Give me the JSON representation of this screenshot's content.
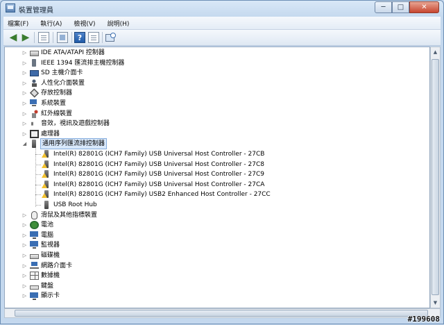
{
  "window": {
    "title": "裝置管理員",
    "controls": {
      "minimize": "─",
      "maximize": "□",
      "close": "✕"
    }
  },
  "menu": [
    "檔案(F)",
    "執行(A)",
    "檢視(V)",
    "說明(H)"
  ],
  "toolbar": {
    "icons": [
      "back-arrow-icon",
      "forward-arrow-icon",
      "grid-view-icon",
      "properties-icon",
      "help-icon",
      "display-icon",
      "scan-hardware-icon"
    ]
  },
  "tree": [
    {
      "label": "IDE ATA/ATAPI 控制器",
      "icon": "ide-controller-icon",
      "level": 0,
      "expanded": false
    },
    {
      "label": "IEEE 1394 匯流排主機控制器",
      "icon": "ieee1394-icon",
      "level": 0,
      "expanded": false
    },
    {
      "label": "SD 主機介面卡",
      "icon": "sd-card-icon",
      "level": 0,
      "expanded": false
    },
    {
      "label": "人性化介面裝置",
      "icon": "hid-icon",
      "level": 0,
      "expanded": false
    },
    {
      "label": "存放控制器",
      "icon": "storage-controller-icon",
      "level": 0,
      "expanded": false
    },
    {
      "label": "系統裝置",
      "icon": "system-device-icon",
      "level": 0,
      "expanded": false
    },
    {
      "label": "紅外線裝置",
      "icon": "infrared-icon",
      "level": 0,
      "expanded": false
    },
    {
      "label": "音效，視訊及遊戲控制器",
      "icon": "speaker-icon",
      "level": 0,
      "expanded": false
    },
    {
      "label": "處理器",
      "icon": "processor-icon",
      "level": 0,
      "expanded": false
    },
    {
      "label": "通用序列匯流排控制器",
      "icon": "usb-controller-icon",
      "level": 0,
      "expanded": true,
      "selected": true
    },
    {
      "label": "Intel(R) 82801G (ICH7 Family) USB Universal Host Controller - 27CB",
      "icon": "usb-warning-icon",
      "level": 1
    },
    {
      "label": "Intel(R) 82801G (ICH7 Family) USB Universal Host Controller - 27C8",
      "icon": "usb-warning-icon",
      "level": 1
    },
    {
      "label": "Intel(R) 82801G (ICH7 Family) USB Universal Host Controller - 27C9",
      "icon": "usb-warning-icon",
      "level": 1
    },
    {
      "label": "Intel(R) 82801G (ICH7 Family) USB Universal Host Controller - 27CA",
      "icon": "usb-warning-icon",
      "level": 1
    },
    {
      "label": "Intel(R) 82801G (ICH7 Family) USB2 Enhanced Host Controller - 27CC",
      "icon": "usb-warning-icon",
      "level": 1
    },
    {
      "label": "USB Root Hub",
      "icon": "usb-icon",
      "level": 1
    },
    {
      "label": "滑鼠及其他指標裝置",
      "icon": "mouse-icon",
      "level": 0,
      "expanded": false
    },
    {
      "label": "電池",
      "icon": "battery-icon",
      "level": 0,
      "expanded": false
    },
    {
      "label": "電腦",
      "icon": "computer-icon",
      "level": 0,
      "expanded": false
    },
    {
      "label": "監視器",
      "icon": "monitor-icon",
      "level": 0,
      "expanded": false
    },
    {
      "label": "磁碟機",
      "icon": "disk-drive-icon",
      "level": 0,
      "expanded": false
    },
    {
      "label": "網路介面卡",
      "icon": "network-adapter-icon",
      "level": 0,
      "expanded": false
    },
    {
      "label": "數據機",
      "icon": "modem-icon",
      "level": 0,
      "expanded": false
    },
    {
      "label": "鍵盤",
      "icon": "keyboard-icon",
      "level": 0,
      "expanded": false
    },
    {
      "label": "顯示卡",
      "icon": "display-adapter-icon",
      "level": 0,
      "expanded": false
    }
  ],
  "watermark": "#199608"
}
